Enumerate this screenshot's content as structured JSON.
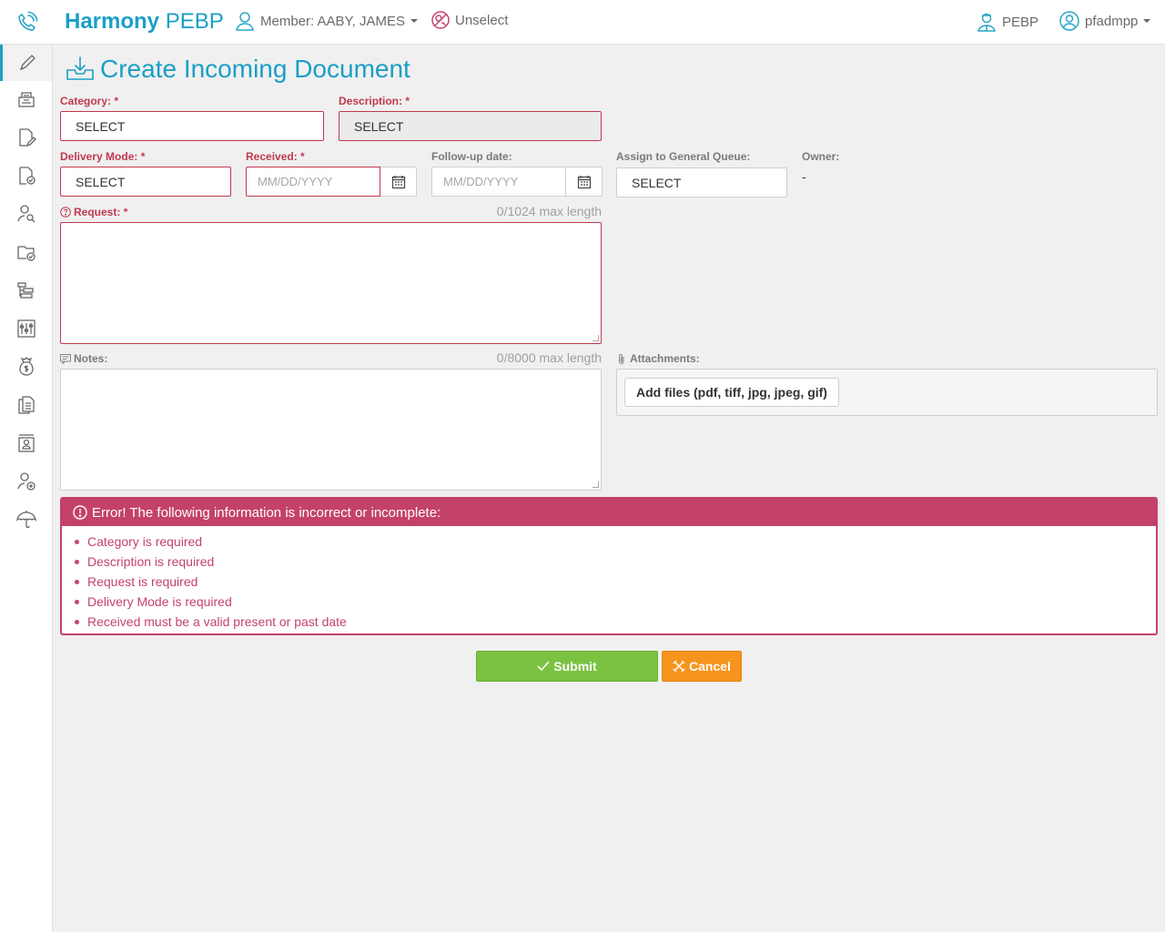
{
  "header": {
    "brand_bold": "Harmony",
    "brand_light": "PEBP",
    "member_label": "Member: AABY, JAMES",
    "unselect_label": "Unselect",
    "context_label": "PEBP",
    "user_label": "pfadmpp"
  },
  "sidebar": {
    "items": [
      {
        "icon": "pencil-icon",
        "active": true
      },
      {
        "icon": "documents-stack-icon"
      },
      {
        "icon": "document-edit-icon"
      },
      {
        "icon": "document-check-icon"
      },
      {
        "icon": "user-search-icon"
      },
      {
        "icon": "folder-check-icon"
      },
      {
        "icon": "hierarchy-icon"
      },
      {
        "icon": "sliders-icon"
      },
      {
        "icon": "money-bag-icon"
      },
      {
        "icon": "copy-documents-icon"
      },
      {
        "icon": "contact-card-icon"
      },
      {
        "icon": "user-add-icon"
      },
      {
        "icon": "umbrella-icon"
      }
    ]
  },
  "page": {
    "title": "Create Incoming Document"
  },
  "form": {
    "category_label": "Category:",
    "category_value": "SELECT",
    "description_label": "Description:",
    "description_value": "SELECT",
    "delivery_mode_label": "Delivery Mode:",
    "delivery_mode_value": "SELECT",
    "received_label": "Received:",
    "received_placeholder": "MM/DD/YYYY",
    "followup_label": "Follow-up date:",
    "followup_placeholder": "MM/DD/YYYY",
    "queue_label": "Assign to General Queue:",
    "queue_value": "SELECT",
    "owner_label": "Owner:",
    "owner_value": "-",
    "request_label": "Request:",
    "request_counter": "0/1024 max length",
    "notes_label": "Notes:",
    "notes_counter": "0/8000 max length",
    "attachments_label": "Attachments:",
    "add_files_label": "Add files (pdf, tiff, jpg, jpeg, gif)",
    "required_mark": "*"
  },
  "errors": {
    "heading": "Error! The following information is incorrect or incomplete:",
    "items": [
      "Category is required",
      "Description is required",
      "Request is required",
      "Delivery Mode is required",
      "Received must be a valid present or past date"
    ]
  },
  "actions": {
    "submit_label": "Submit",
    "cancel_label": "Cancel"
  },
  "colors": {
    "brand": "#1a9fc7",
    "error": "#c4426a",
    "submit": "#7cc242",
    "cancel": "#f7941d"
  }
}
